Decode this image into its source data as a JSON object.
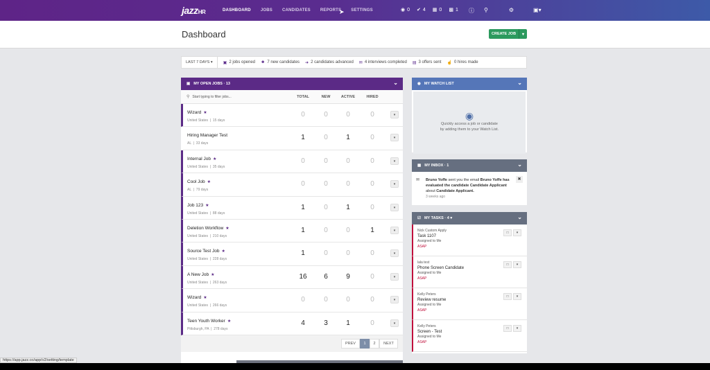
{
  "nav": {
    "logo": "jazz",
    "logo_suffix": "HR",
    "links": [
      "DASHBOARD",
      "JOBS",
      "CANDIDATES",
      "REPORTS",
      "SETTINGS"
    ],
    "active": "DASHBOARD",
    "counts": {
      "views": "0",
      "checks": "4",
      "calendar": "0",
      "inbox": "1"
    }
  },
  "header": {
    "title": "Dashboard",
    "create_label": "CREATE JOB"
  },
  "stats": {
    "period": "LAST 7 DAYS",
    "items": [
      "2 jobs opened",
      "7 new candidates",
      "2 candidates advanced",
      "4 interviews completed",
      "3 offers sent",
      "0 hires made"
    ]
  },
  "jobs": {
    "title": "MY OPEN JOBS · 13",
    "filter_placeholder": "Start typing to filter jobs...",
    "columns": [
      "TOTAL",
      "NEW",
      "ACTIVE",
      "HIRED"
    ],
    "rows": [
      {
        "name": "Wizard",
        "starred": true,
        "location": "United States",
        "age": "15 days",
        "total": "0",
        "new": "0",
        "active": "0",
        "hired": "0"
      },
      {
        "name": "Hiring Manager Test",
        "starred": false,
        "location": "AL",
        "age": "33 days",
        "total": "1",
        "new": "0",
        "active": "1",
        "hired": "0"
      },
      {
        "name": "Internal Job",
        "starred": true,
        "location": "United States",
        "age": "35 days",
        "total": "0",
        "new": "0",
        "active": "0",
        "hired": "0"
      },
      {
        "name": "Cool Job",
        "starred": true,
        "location": "AL",
        "age": "79 days",
        "total": "0",
        "new": "0",
        "active": "0",
        "hired": "0"
      },
      {
        "name": "Job 123",
        "starred": true,
        "location": "United States",
        "age": "88 days",
        "total": "1",
        "new": "0",
        "active": "1",
        "hired": "0"
      },
      {
        "name": "Deletion Workflow",
        "starred": true,
        "location": "United States",
        "age": "210 days",
        "total": "1",
        "new": "0",
        "active": "0",
        "hired": "1"
      },
      {
        "name": "Source Test Job",
        "starred": true,
        "location": "United States",
        "age": "228 days",
        "total": "1",
        "new": "0",
        "active": "0",
        "hired": "0"
      },
      {
        "name": "A New Job",
        "starred": true,
        "location": "United States",
        "age": "263 days",
        "total": "16",
        "new": "6",
        "active": "9",
        "hired": "0"
      },
      {
        "name": "Wizard",
        "starred": true,
        "location": "United States",
        "age": "266 days",
        "total": "0",
        "new": "0",
        "active": "0",
        "hired": "0"
      },
      {
        "name": "Teen Youth Worker",
        "starred": true,
        "location": "Pittsburgh, PA",
        "age": "278 days",
        "total": "4",
        "new": "3",
        "active": "1",
        "hired": "0"
      }
    ],
    "pager": {
      "prev": "PREV",
      "pages": [
        "1",
        "2"
      ],
      "current": "1",
      "next": "NEXT"
    }
  },
  "watch": {
    "title": "MY WATCH LIST",
    "text1": "Quickly access a job or candidate",
    "text2": "by adding them to your Watch List."
  },
  "inbox": {
    "title": "MY INBOX · 1",
    "sender": "Bruno Yoffe",
    "mid": "sent you the email",
    "subject": "Bruno Yoffe has evaluated the candidate Candidate Applicant",
    "about": "about",
    "candidate": "Candidate Applicant.",
    "ago": "3 weeks ago"
  },
  "tasks": {
    "title": "MY TASKS · 4",
    "items": [
      {
        "who": "Nick Custom Apply",
        "title": "Task 1107",
        "assigned": "Assigned to Me",
        "priority": "ASAP"
      },
      {
        "who": "lala test",
        "title": "Phone Screen Candidate",
        "assigned": "Assigned to Me",
        "priority": "ASAP"
      },
      {
        "who": "Kelly Peters",
        "title": "Review resume",
        "assigned": "Assigned to Me",
        "priority": "ASAP"
      },
      {
        "who": "Kelly Peters",
        "title": "Screen - Test",
        "assigned": "Assigned to Me",
        "priority": "ASAP"
      }
    ]
  },
  "status_url": "https://app.jazz.co/app/v2/setting/template",
  "colors": {
    "brand": "#5b2a86",
    "watch": "#5576b8",
    "panel": "#666f80",
    "create": "#2c9a5e",
    "asap": "#c0103c"
  }
}
